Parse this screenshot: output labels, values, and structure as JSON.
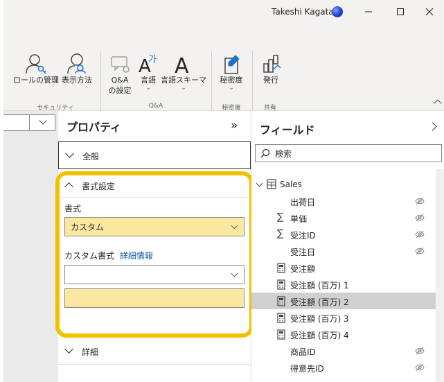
{
  "titlebar": {
    "user_name": "Takeshi Kagata"
  },
  "ribbon": {
    "buttons": [
      {
        "label": "ロールの管理",
        "icon": "person-key-icon"
      },
      {
        "label": "表示方法",
        "icon": "person-search-icon"
      },
      {
        "label": "Q&A\nの設定",
        "icon": "qa-settings-icon"
      },
      {
        "label": "言語",
        "icon": "language-icon"
      },
      {
        "label": "言語スキーマ",
        "icon": "linguistic-schema-icon"
      },
      {
        "label": "秘密度",
        "icon": "sensitivity-icon"
      },
      {
        "label": "発行",
        "icon": "publish-icon"
      }
    ],
    "groups": [
      "セキュリティ",
      "Q&A",
      "秘密度",
      "共有"
    ]
  },
  "properties": {
    "title": "プロパティ",
    "sections": {
      "general": "全般",
      "format": "書式設定",
      "detail": "詳細"
    },
    "format_label": "書式",
    "format_value": "カスタム",
    "custom_format_label": "カスタム書式",
    "more_info_link": "詳細情報",
    "custom_format_value": "",
    "custom_format_text": ""
  },
  "fields": {
    "title": "フィールド",
    "search_placeholder": "検索",
    "table_name": "Sales",
    "items": [
      {
        "label": "出荷日",
        "kind": "plain",
        "hidden": true
      },
      {
        "label": "単価",
        "kind": "sum",
        "hidden": true
      },
      {
        "label": "受注ID",
        "kind": "sum",
        "hidden": true
      },
      {
        "label": "受注日",
        "kind": "plain",
        "hidden": true
      },
      {
        "label": "受注額",
        "kind": "measure",
        "hidden": false
      },
      {
        "label": "受注額 (百万) 1",
        "kind": "measure",
        "hidden": false
      },
      {
        "label": "受注額 (百万) 2",
        "kind": "measure",
        "hidden": false,
        "selected": true
      },
      {
        "label": "受注額 (百万) 3",
        "kind": "measure",
        "hidden": false
      },
      {
        "label": "受注額 (百万) 4",
        "kind": "measure",
        "hidden": false
      },
      {
        "label": "商品ID",
        "kind": "plain",
        "hidden": true
      },
      {
        "label": "得意先ID",
        "kind": "plain",
        "hidden": true
      }
    ]
  },
  "colors": {
    "highlight": "#f2c200",
    "selected_fill": "#fae8a1",
    "link": "#1a5ca8"
  }
}
